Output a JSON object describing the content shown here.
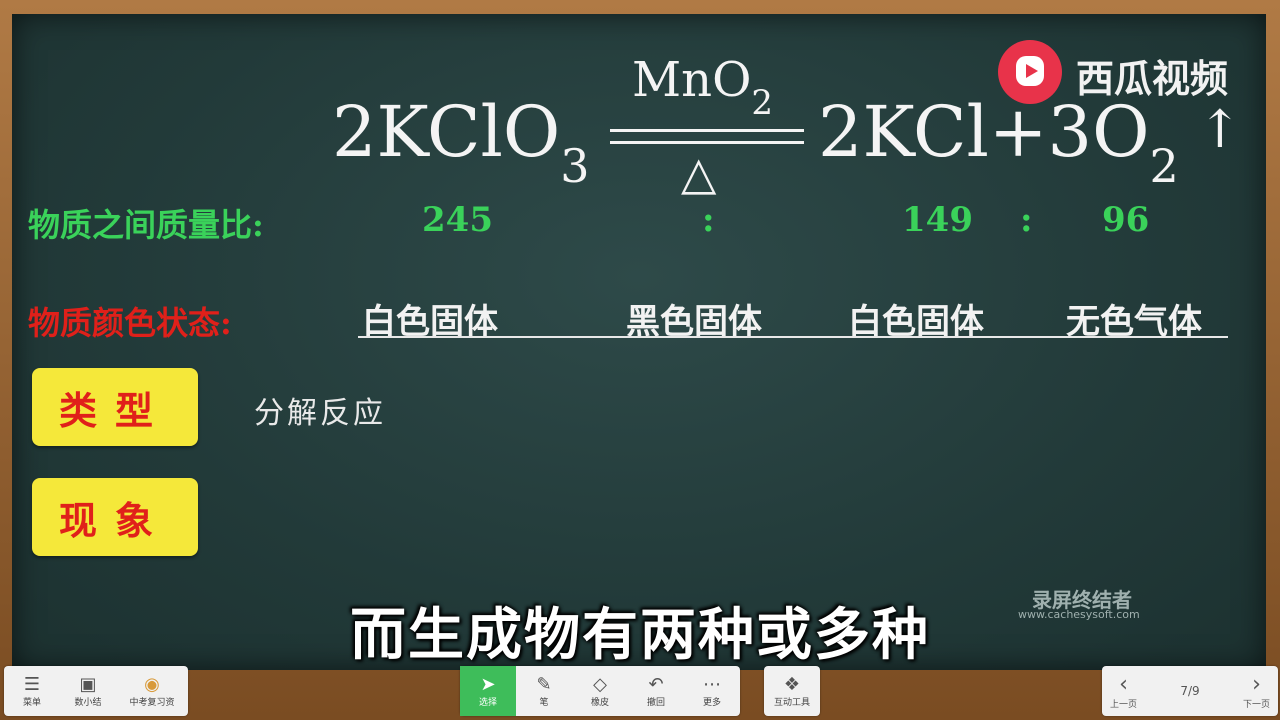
{
  "equation": {
    "lhs_coef": "2KClO",
    "lhs_sub": "3",
    "catalyst": "MnO",
    "catalyst_sub": "2",
    "heat_symbol": "△",
    "rhs_main": "2KCl+3O",
    "rhs_sub": "2",
    "gas_arrow": "↑"
  },
  "mass_ratio": {
    "label": "物质之间质量比:",
    "v1": "245",
    "sep1": ":",
    "v2": "149",
    "sep2": ":",
    "v3": "96"
  },
  "color_state": {
    "label": "物质颜色状态:",
    "s1": "白色固体",
    "s2": "黑色固体",
    "s3": "白色固体",
    "s4": "无色气体"
  },
  "type_button": "类型",
  "type_value": "分解反应",
  "phenomenon_button": "现象",
  "subtitle": "而生成物有两种或多种",
  "watermark": {
    "brand": "西瓜视频",
    "recorder": "录屏终结者",
    "recorder_url": "www.cachesysoft.com"
  },
  "toolbar": {
    "left": [
      {
        "icon": "menu-icon",
        "glyph": "☰",
        "label": "菜单"
      },
      {
        "icon": "slides-icon",
        "glyph": "▣",
        "label": "数小结"
      },
      {
        "icon": "avatar-icon",
        "glyph": "◉",
        "label": "中考复习资"
      }
    ],
    "center": [
      {
        "icon": "cursor-icon",
        "glyph": "➤",
        "label": "选择"
      },
      {
        "icon": "pen-icon",
        "glyph": "✎",
        "label": "笔"
      },
      {
        "icon": "eraser-icon",
        "glyph": "◇",
        "label": "橡皮"
      },
      {
        "icon": "undo-icon",
        "glyph": "↶",
        "label": "撤回"
      },
      {
        "icon": "more-icon",
        "glyph": "⋯",
        "label": "更多"
      }
    ],
    "right_tool": {
      "icon": "interact-icon",
      "glyph": "❖",
      "label": "互动工具"
    },
    "pager": {
      "prev": "上一页",
      "current": "7/9",
      "next": "下一页"
    }
  }
}
